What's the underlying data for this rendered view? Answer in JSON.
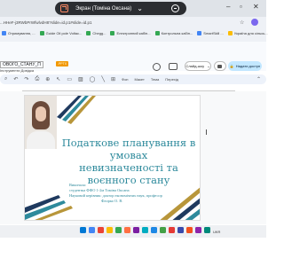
{
  "share_bar": {
    "title": "Экран (Томіна Оксана)",
    "colors": {
      "pill": "#2b2d31",
      "screen_icon": "#ff8a65"
    }
  },
  "browser": {
    "url": "...HHeF-j3RWbPrWfwlvdH8?slide=id.p1#slide=id.p1",
    "bookmarks": [
      {
        "label": "Отримування, ...",
        "color": "#4285f4"
      },
      {
        "label": "Guide Oil pole Voltac...",
        "color": "#34a853"
      },
      {
        "label": "Chegg...",
        "color": "#34a853"
      },
      {
        "label": "Електронний кабін...",
        "color": "#34a853"
      },
      {
        "label": "Контрольна кабін...",
        "color": "#34a853"
      },
      {
        "label": "SmartSkill ...",
        "color": "#4285f4"
      },
      {
        "label": "Україна для сільсь...",
        "color": "#fbbc04"
      }
    ]
  },
  "app": {
    "doc_title": "ОВОГО_СТАНУ_П",
    "badge": ".PPTX",
    "menu": "Інструменти  Довідка",
    "slideshow_label": "Слайд-шоу",
    "share_label": "Надати доступ",
    "share_color": "#c2e7ff"
  },
  "toolbar": {
    "items": [
      "Фон",
      "Макет",
      "Тема",
      "Перехід"
    ]
  },
  "slide": {
    "title_lines": [
      "Податкове планування в умовах",
      "невизначеності та воєнного стану"
    ],
    "info_lines": [
      "Виконала:",
      "студентка ФФО 1-2м Томіна Оксана",
      "Науковий керівник:  доктор економічних наук, професор",
      "Флорко О. В."
    ],
    "accent_colors": {
      "teal": "#2e8a9c",
      "gold": "#b8963a",
      "navy": "#1f3a5f"
    }
  },
  "taskbar": {
    "tray_text": "UKR"
  }
}
